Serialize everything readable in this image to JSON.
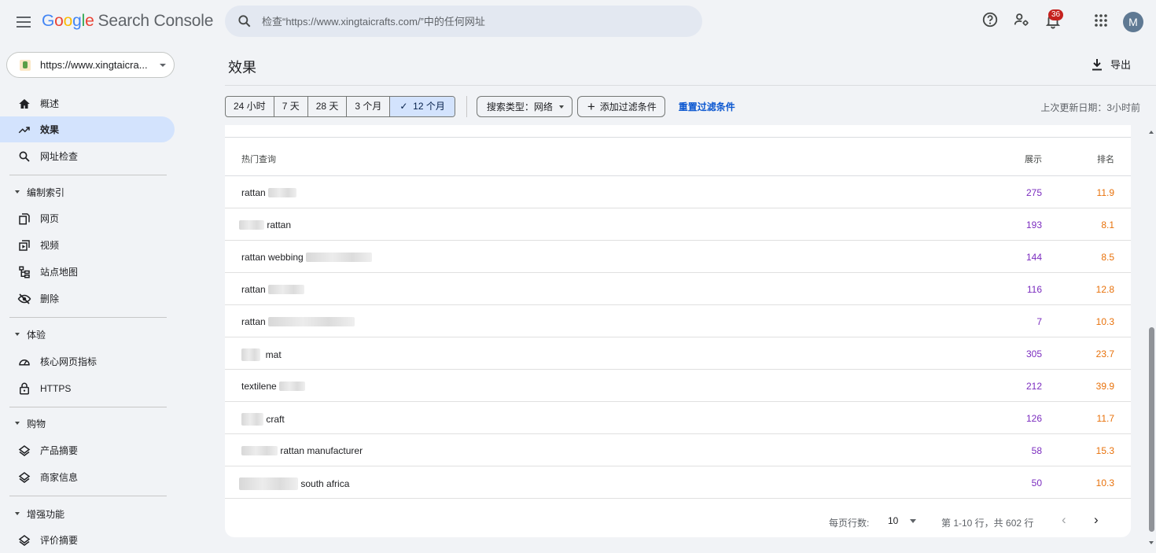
{
  "app": {
    "logo_google": [
      "G",
      "o",
      "o",
      "g",
      "l",
      "e"
    ],
    "product_name": "Search Console"
  },
  "search": {
    "placeholder": "检查“https://www.xingtaicrafts.com/”中的任何网址"
  },
  "header": {
    "notification_count": "36",
    "avatar_letter": "M",
    "icons": [
      "menu-icon",
      "search-icon",
      "help-icon",
      "manage-users-icon",
      "notifications-icon",
      "apps-icon"
    ]
  },
  "sidebar": {
    "property_url": "https://www.xingtaicra...",
    "items": [
      {
        "label": "概述",
        "icon": "home-icon"
      },
      {
        "label": "效果",
        "icon": "trending-up-icon",
        "active": true
      },
      {
        "label": "网址检查",
        "icon": "search-icon"
      }
    ],
    "sections": [
      {
        "label": "编制索引",
        "items": [
          {
            "label": "网页",
            "icon": "pages-icon"
          },
          {
            "label": "视频",
            "icon": "video-icon"
          },
          {
            "label": "站点地图",
            "icon": "sitemap-icon"
          },
          {
            "label": "删除",
            "icon": "removal-icon"
          }
        ]
      },
      {
        "label": "体验",
        "items": [
          {
            "label": "核心网页指标",
            "icon": "speed-icon"
          },
          {
            "label": "HTTPS",
            "icon": "lock-icon"
          }
        ]
      },
      {
        "label": "购物",
        "items": [
          {
            "label": "产品摘要",
            "icon": "diamond-icon"
          },
          {
            "label": "商家信息",
            "icon": "diamond-icon"
          }
        ]
      },
      {
        "label": "增强功能",
        "items": [
          {
            "label": "评价摘要",
            "icon": "diamond-icon"
          }
        ]
      }
    ]
  },
  "main": {
    "title": "效果",
    "export_label": "导出",
    "date_ranges": [
      "24 小时",
      "7 天",
      "28 天",
      "3 个月",
      "12 个月"
    ],
    "selected_range": "12 个月",
    "search_type": "搜索类型：网络",
    "add_filter": "添加过滤条件",
    "reset_filter": "重置过滤条件",
    "last_updated": "上次更新日期：3小时前"
  },
  "table": {
    "headers": {
      "query": "热门查询",
      "impressions": "展示",
      "position": "排名"
    },
    "rows": [
      {
        "prefix": "rattan",
        "suffix": "",
        "impressions": "275",
        "position": "11.9"
      },
      {
        "prefix": "",
        "suffix": "rattan",
        "impressions": "193",
        "position": "8.1"
      },
      {
        "prefix": "rattan webbing",
        "suffix": "",
        "impressions": "144",
        "position": "8.5"
      },
      {
        "prefix": "rattan",
        "suffix": "",
        "impressions": "116",
        "position": "12.8"
      },
      {
        "prefix": "rattan",
        "suffix": "",
        "impressions": "7",
        "position": "10.3"
      },
      {
        "prefix": "",
        "suffix": "mat",
        "impressions": "305",
        "position": "23.7"
      },
      {
        "prefix": "textilene",
        "suffix": "",
        "impressions": "212",
        "position": "39.9"
      },
      {
        "prefix": "",
        "suffix": "craft",
        "impressions": "126",
        "position": "11.7"
      },
      {
        "prefix": "",
        "suffix": "rattan manufacturer",
        "impressions": "58",
        "position": "15.3"
      },
      {
        "prefix": "",
        "suffix": "south africa",
        "impressions": "50",
        "position": "10.3"
      }
    ]
  },
  "pagination": {
    "rows_per_page_label": "每页行数:",
    "rows_per_page": "10",
    "range": "第 1-10 行，共 602 行"
  },
  "colors": {
    "impressions": "#7b2cbf",
    "position": "#e8710a",
    "active_nav": "#d3e3fd",
    "link": "#0b57d0"
  }
}
